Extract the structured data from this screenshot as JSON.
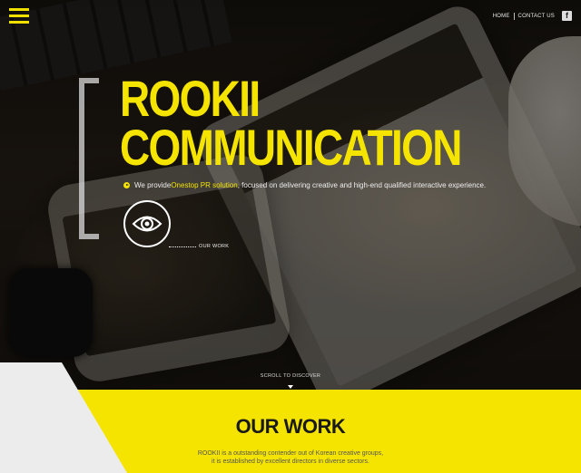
{
  "header": {
    "menu_icon": "hamburger-menu-icon",
    "nav": [
      {
        "label": "HOME"
      },
      {
        "label": "CONTACT US"
      }
    ],
    "facebook_icon": "f"
  },
  "hero": {
    "title_line1": "ROOKII",
    "title_line2": "COMMUNICATION",
    "tagline_prefix": "We provide ",
    "tagline_highlight": "Onestop PR solution",
    "tagline_suffix": ", focused on delivering creative and high-end qualified interactive experience.",
    "our_work_label": "OUR WORK",
    "scroll_label": "SCROLL TO DISCOVER"
  },
  "section": {
    "title": "OUR WORK",
    "desc_line1": "ROOKII is a outstanding contender out of Korean creative groups,",
    "desc_line2": "it is established by excellent directors in diverse sectors."
  },
  "colors": {
    "accent": "#f5e400",
    "dark": "#1a1a1a"
  }
}
